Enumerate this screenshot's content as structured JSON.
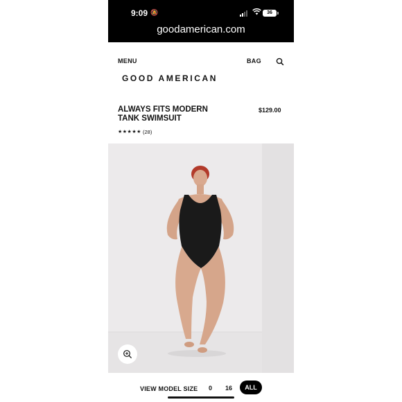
{
  "status_bar": {
    "time": "9:09",
    "battery": "36"
  },
  "browser": {
    "url": "goodamerican.com"
  },
  "header": {
    "menu_label": "MENU",
    "bag_label": "BAG",
    "logo_text": "GOOD AMERICAN"
  },
  "product": {
    "title": "ALWAYS FITS MODERN TANK SWIMSUIT",
    "price": "$129.00",
    "rating_stars": "★★★★★",
    "rating": 5,
    "review_count": "(28)"
  },
  "model_size": {
    "label": "VIEW MODEL SIZE",
    "options": [
      "0",
      "16",
      "ALL"
    ],
    "selected": "ALL"
  },
  "icons": [
    "silent-bell-icon",
    "signal-icon",
    "wifi-icon",
    "battery-icon",
    "search-icon",
    "zoom-in-icon"
  ],
  "colors": {
    "topbar": "#000000",
    "accent": "#000000",
    "photo_bg": "#ebe9ea",
    "swimsuit": "#1a1a1a"
  }
}
